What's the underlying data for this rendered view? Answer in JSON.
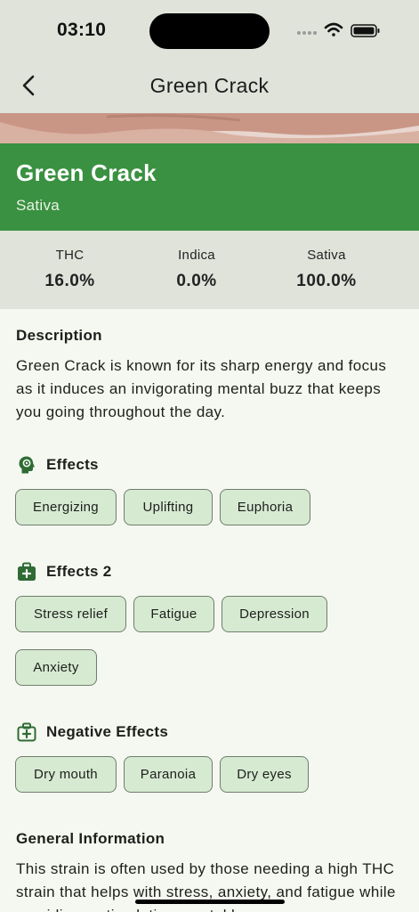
{
  "status": {
    "time": "03:10"
  },
  "nav": {
    "title": "Green Crack",
    "back_icon": "chevron-left-icon"
  },
  "strain": {
    "name": "Green Crack",
    "type": "Sativa"
  },
  "stats": [
    {
      "label": "THC",
      "value": "16.0%"
    },
    {
      "label": "Indica",
      "value": "0.0%"
    },
    {
      "label": "Sativa",
      "value": "100.0%"
    }
  ],
  "description": {
    "title": "Description",
    "text": "Green Crack is known for its sharp energy and focus as it induces an invigorating mental buzz that keeps you going throughout the day."
  },
  "effects": {
    "title": "Effects",
    "icon": "head-gear-icon",
    "chips": [
      "Energizing",
      "Uplifting",
      "Euphoria"
    ]
  },
  "effects2": {
    "title": "Effects 2",
    "icon": "medical-kit-icon",
    "chips": [
      "Stress relief",
      "Fatigue",
      "Depression",
      "Anxiety"
    ]
  },
  "negative": {
    "title": "Negative Effects",
    "icon": "medical-kit-outline-icon",
    "chips": [
      "Dry mouth",
      "Paranoia",
      "Dry eyes"
    ]
  },
  "general": {
    "title": "General Information",
    "text": "This strain is often used by those needing a high THC strain that helps with stress, anxiety, and fatigue while providing a stimulating mental l"
  },
  "colors": {
    "accent": "#3a9141",
    "chip_bg": "#d6ead2",
    "header_bg": "#dfe3da",
    "page_bg": "#f5f8f0"
  }
}
